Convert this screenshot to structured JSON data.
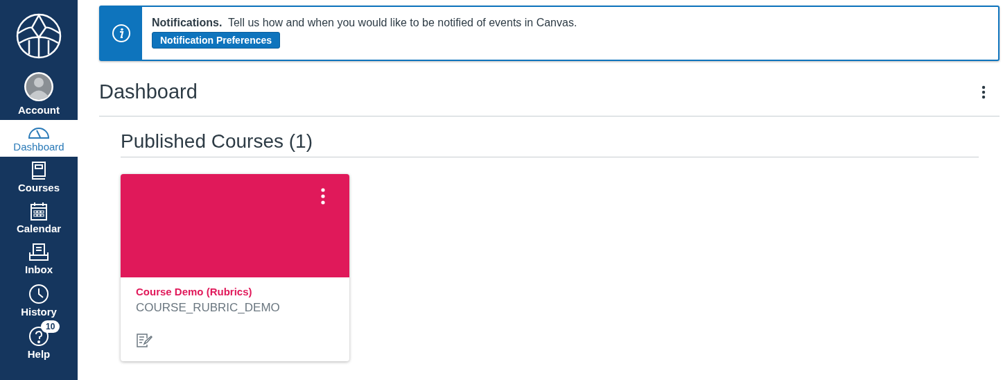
{
  "sidebar": {
    "items": [
      {
        "label": "Account",
        "selected": false
      },
      {
        "label": "Dashboard",
        "selected": true
      },
      {
        "label": "Courses",
        "selected": false
      },
      {
        "label": "Calendar",
        "selected": false
      },
      {
        "label": "Inbox",
        "selected": false
      },
      {
        "label": "History",
        "selected": false
      },
      {
        "label": "Help",
        "selected": false,
        "badge": "10"
      }
    ]
  },
  "notification": {
    "message": "**Notifications.**  Tell us how and when you would like to be notified of events in Canvas.",
    "button": "Notification Preferences"
  },
  "page_title": "Dashboard",
  "section_title": "Published Courses (1)",
  "courses": [
    {
      "name": "Course Demo (Rubrics)",
      "code": "COURSE_RUBRIC_DEMO",
      "color": "#e0195a"
    }
  ]
}
